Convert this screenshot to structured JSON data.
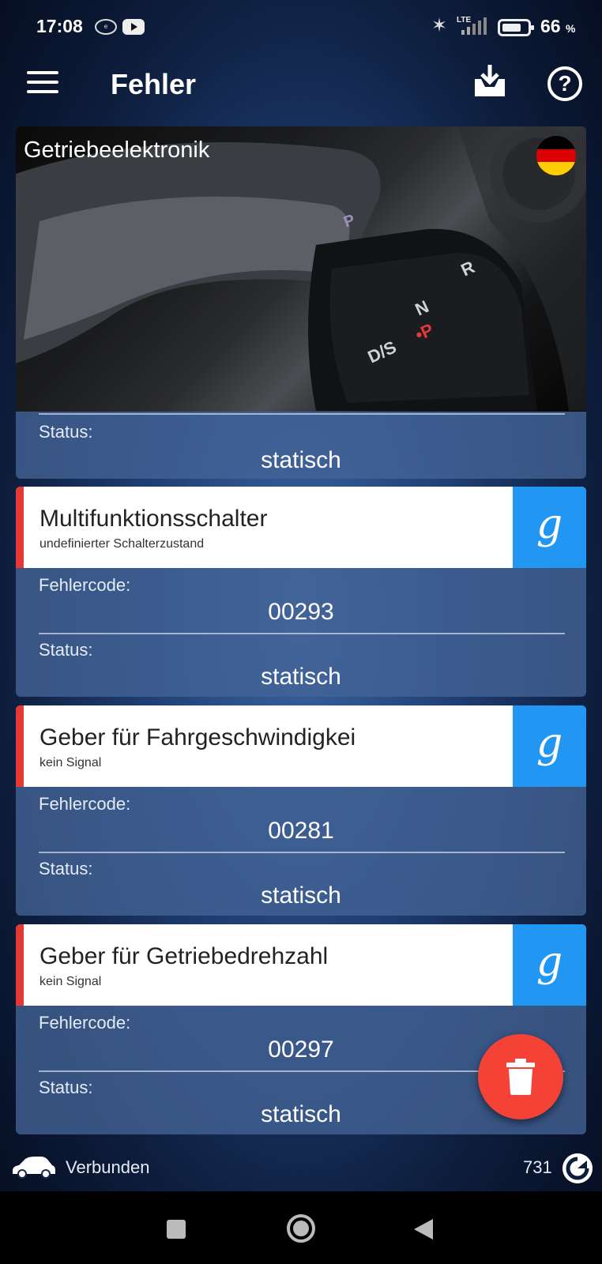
{
  "status_bar": {
    "time": "17:08",
    "battery_percent": "66",
    "battery_unit": "%",
    "network": "LTE",
    "icons": [
      "ebay-notification-icon",
      "youtube-icon",
      "bluetooth-icon",
      "signal-icon",
      "battery-icon"
    ]
  },
  "app_bar": {
    "title": "Fehler",
    "icons": [
      "menu-icon",
      "download-icon",
      "help-icon"
    ]
  },
  "module": {
    "name": "Getriebeelektronik",
    "language_flag": "german-flag",
    "status_label": "Status:",
    "status_value": "statisch"
  },
  "faults": [
    {
      "title": "Multifunktionsschalter",
      "subtitle": "undefinierter Schalterzustand",
      "code_label": "Fehlercode:",
      "code": "00293",
      "status_label": "Status:",
      "status": "statisch",
      "search_glyph": "g"
    },
    {
      "title": "Geber für Fahrgeschwindigkei",
      "subtitle": "kein Signal",
      "code_label": "Fehlercode:",
      "code": "00281",
      "status_label": "Status:",
      "status": "statisch",
      "search_glyph": "g"
    },
    {
      "title": "Geber für Getriebedrehzahl",
      "subtitle": "kein Signal",
      "code_label": "Fehlercode:",
      "code": "00297",
      "status_label": "Status:",
      "status": "statisch",
      "search_glyph": "g"
    }
  ],
  "bottom_bar": {
    "connection": "Verbunden",
    "count": "731"
  },
  "colors": {
    "accent_red": "#e53935",
    "google_blue": "#2196f3",
    "fab_red": "#f44336"
  }
}
